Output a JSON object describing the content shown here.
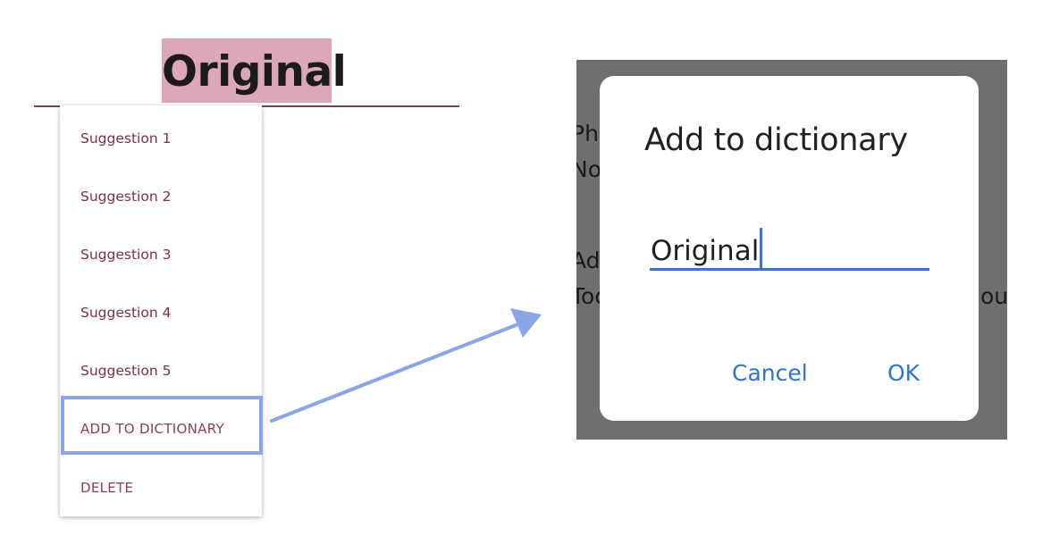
{
  "edit_text": {
    "selected_word": "Original",
    "highlight_color": "#dca8b9",
    "underline_color": "#7b3d52"
  },
  "popup_menu": {
    "items": [
      {
        "label": "Suggestion 1"
      },
      {
        "label": "Suggestion 2"
      },
      {
        "label": "Suggestion 3"
      },
      {
        "label": "Suggestion 4"
      },
      {
        "label": "Suggestion 5"
      },
      {
        "label": "ADD TO DICTIONARY"
      },
      {
        "label": "DELETE"
      }
    ],
    "text_color": "#7d2f4c",
    "highlighted_item": "ADD TO DICTIONARY",
    "highlight_color": "#8aa6e6"
  },
  "arrow": {
    "color": "#8aa6e6"
  },
  "background_fragments": [
    "Ph",
    "No",
    "Adv",
    "Too",
    "ou"
  ],
  "dialog": {
    "title": "Add to dictionary",
    "input_value": "Original",
    "cancel_label": "Cancel",
    "ok_label": "OK",
    "accent_color": "#2f73d1"
  }
}
